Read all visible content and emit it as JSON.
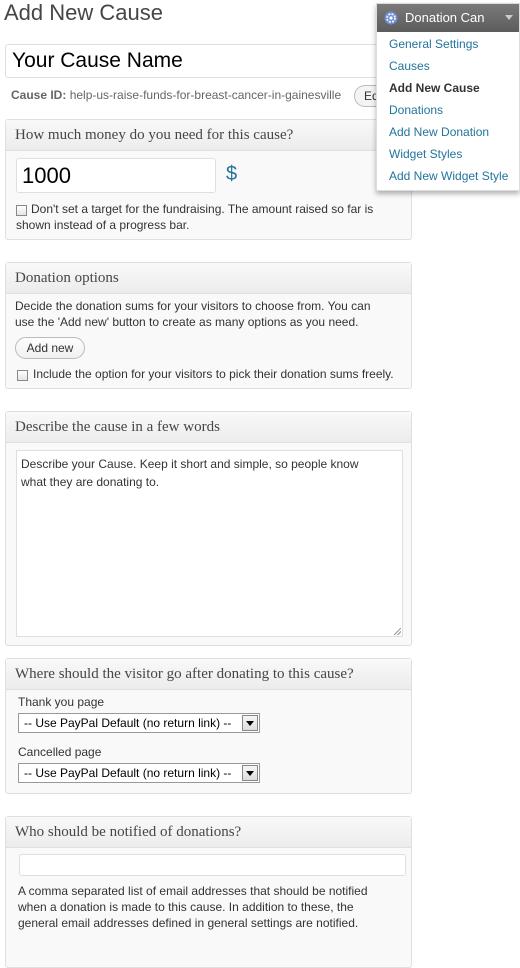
{
  "page": {
    "title": "Add New Cause"
  },
  "cause": {
    "name_value": "Your Cause Name",
    "id_label": "Cause ID:",
    "id_value": "help-us-raise-funds-for-breast-cancer-in-gainesville",
    "edit_label": "Edit"
  },
  "amount_box": {
    "title": "How much money do you need for this cause?",
    "amount_value": "1000",
    "currency_symbol": "$",
    "no_target_label_line1": "Don't set a target for the fundraising. The amount raised so far is",
    "no_target_label_line2": "shown instead of a progress bar."
  },
  "options_box": {
    "title": "Donation options",
    "desc_line1": "Decide the donation sums for your visitors to choose from. You can",
    "desc_line2": "use the 'Add new' button to create as many options as you need.",
    "add_new_label": "Add new",
    "free_sum_label": "Include the option for your visitors to pick their donation sums freely."
  },
  "describe_box": {
    "title": "Describe the cause in a few words",
    "text_line1": "Describe your Cause. Keep it short and simple, so people know",
    "text_line2": "what they are donating to."
  },
  "redirect_box": {
    "title": "Where should the visitor go after donating to this cause?",
    "thank_you_label": "Thank you page",
    "thank_you_selected": "-- Use PayPal Default (no return link) --",
    "cancelled_label": "Cancelled page",
    "cancelled_selected": "-- Use PayPal Default (no return link) --"
  },
  "notify_box": {
    "title": "Who should be notified of donations?",
    "email_value": "",
    "help_line1": "A comma separated list of email addresses that should be notified",
    "help_line2": "when a donation is made to this cause. In addition to these, the",
    "help_line3": "general email addresses defined in general settings are notified."
  },
  "menu": {
    "title": "Donation Can",
    "icon": "gear-icon",
    "items": [
      {
        "label": "General Settings"
      },
      {
        "label": "Causes"
      },
      {
        "label": "Add New Cause"
      },
      {
        "label": "Donations"
      },
      {
        "label": "Add New Donation"
      },
      {
        "label": "Widget Styles"
      },
      {
        "label": "Add New Widget Style"
      }
    ],
    "current_index": 2
  },
  "colors": {
    "link": "#21759b",
    "menu_header": "#6a6a6a",
    "box_border": "#dfdfdf"
  }
}
